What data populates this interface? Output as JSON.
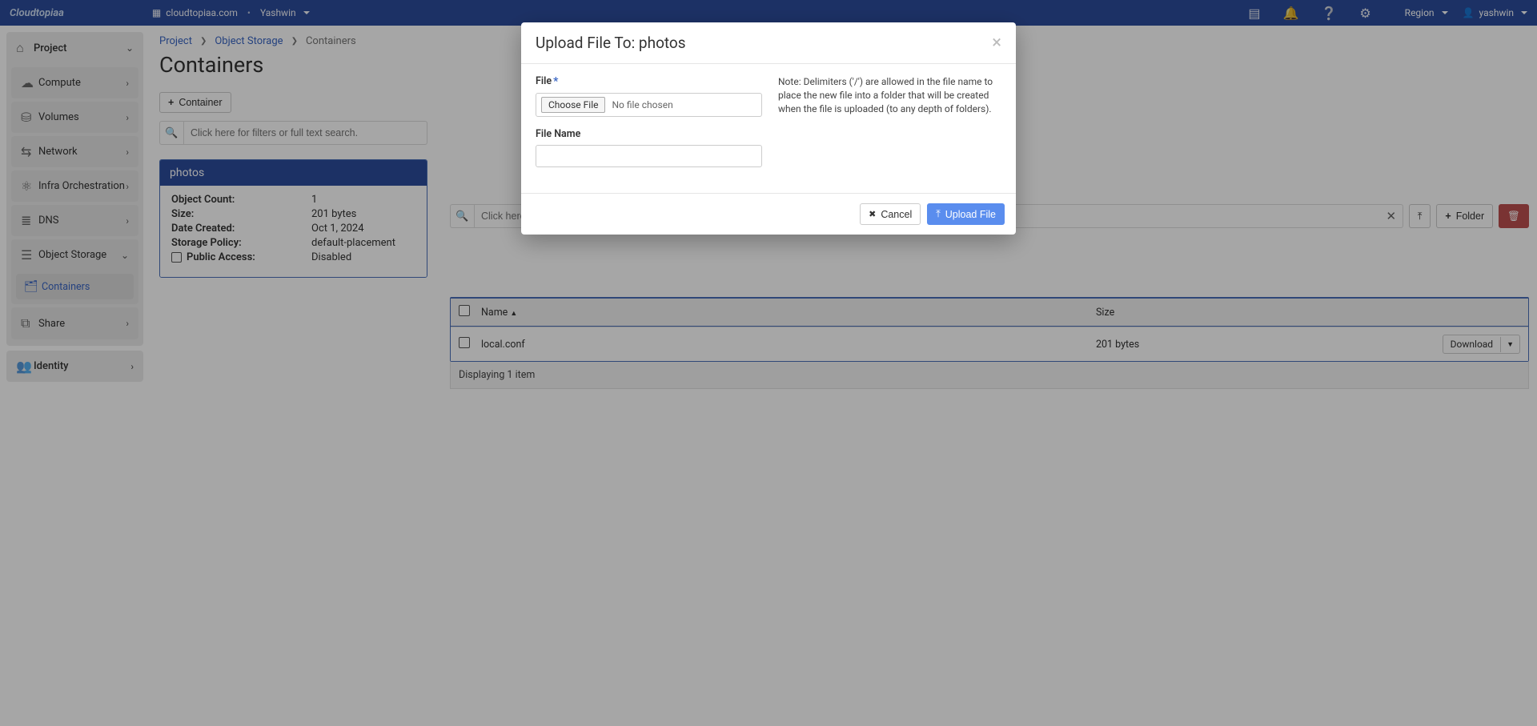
{
  "header": {
    "logo": "Cloudtopiaa",
    "domain": "cloudtopiaa.com",
    "project": "Yashwin",
    "region_label": "Region",
    "user": "yashwin"
  },
  "sidebar": {
    "project_label": "Project",
    "items": [
      {
        "label": "Compute"
      },
      {
        "label": "Volumes"
      },
      {
        "label": "Network"
      },
      {
        "label": "Infra Orchestration"
      },
      {
        "label": "DNS"
      },
      {
        "label": "Object Storage",
        "expanded": true,
        "children": [
          {
            "label": "Containers",
            "active": true
          }
        ]
      },
      {
        "label": "Share"
      }
    ],
    "identity_label": "Identity"
  },
  "crumbs": [
    "Project",
    "Object Storage",
    "Containers"
  ],
  "page_title": "Containers",
  "add_container_label": "Container",
  "filter_placeholder": "Click here for filters or full text search.",
  "container": {
    "name": "photos",
    "kv": {
      "object_count_label": "Object Count:",
      "object_count": "1",
      "size_label": "Size:",
      "size": "201 bytes",
      "date_label": "Date Created:",
      "date": "Oct 1, 2024",
      "policy_label": "Storage Policy:",
      "policy": "default-placement",
      "public_label": "Public Access:",
      "public": "Disabled"
    }
  },
  "right": {
    "folder_label": "Folder",
    "table": {
      "name_col": "Name",
      "size_col": "Size",
      "rows": [
        {
          "name": "local.conf",
          "size": "201 bytes",
          "action": "Download"
        }
      ],
      "footer": "Displaying 1 item"
    }
  },
  "modal": {
    "title": "Upload File To: photos",
    "file_label": "File",
    "choose_file": "Choose File",
    "no_file": "No file chosen",
    "filename_label": "File Name",
    "note": "Note: Delimiters ('/') are allowed in the file name to place the new file into a folder that will be created when the file is uploaded (to any depth of folders).",
    "cancel": "Cancel",
    "upload": "Upload File"
  }
}
